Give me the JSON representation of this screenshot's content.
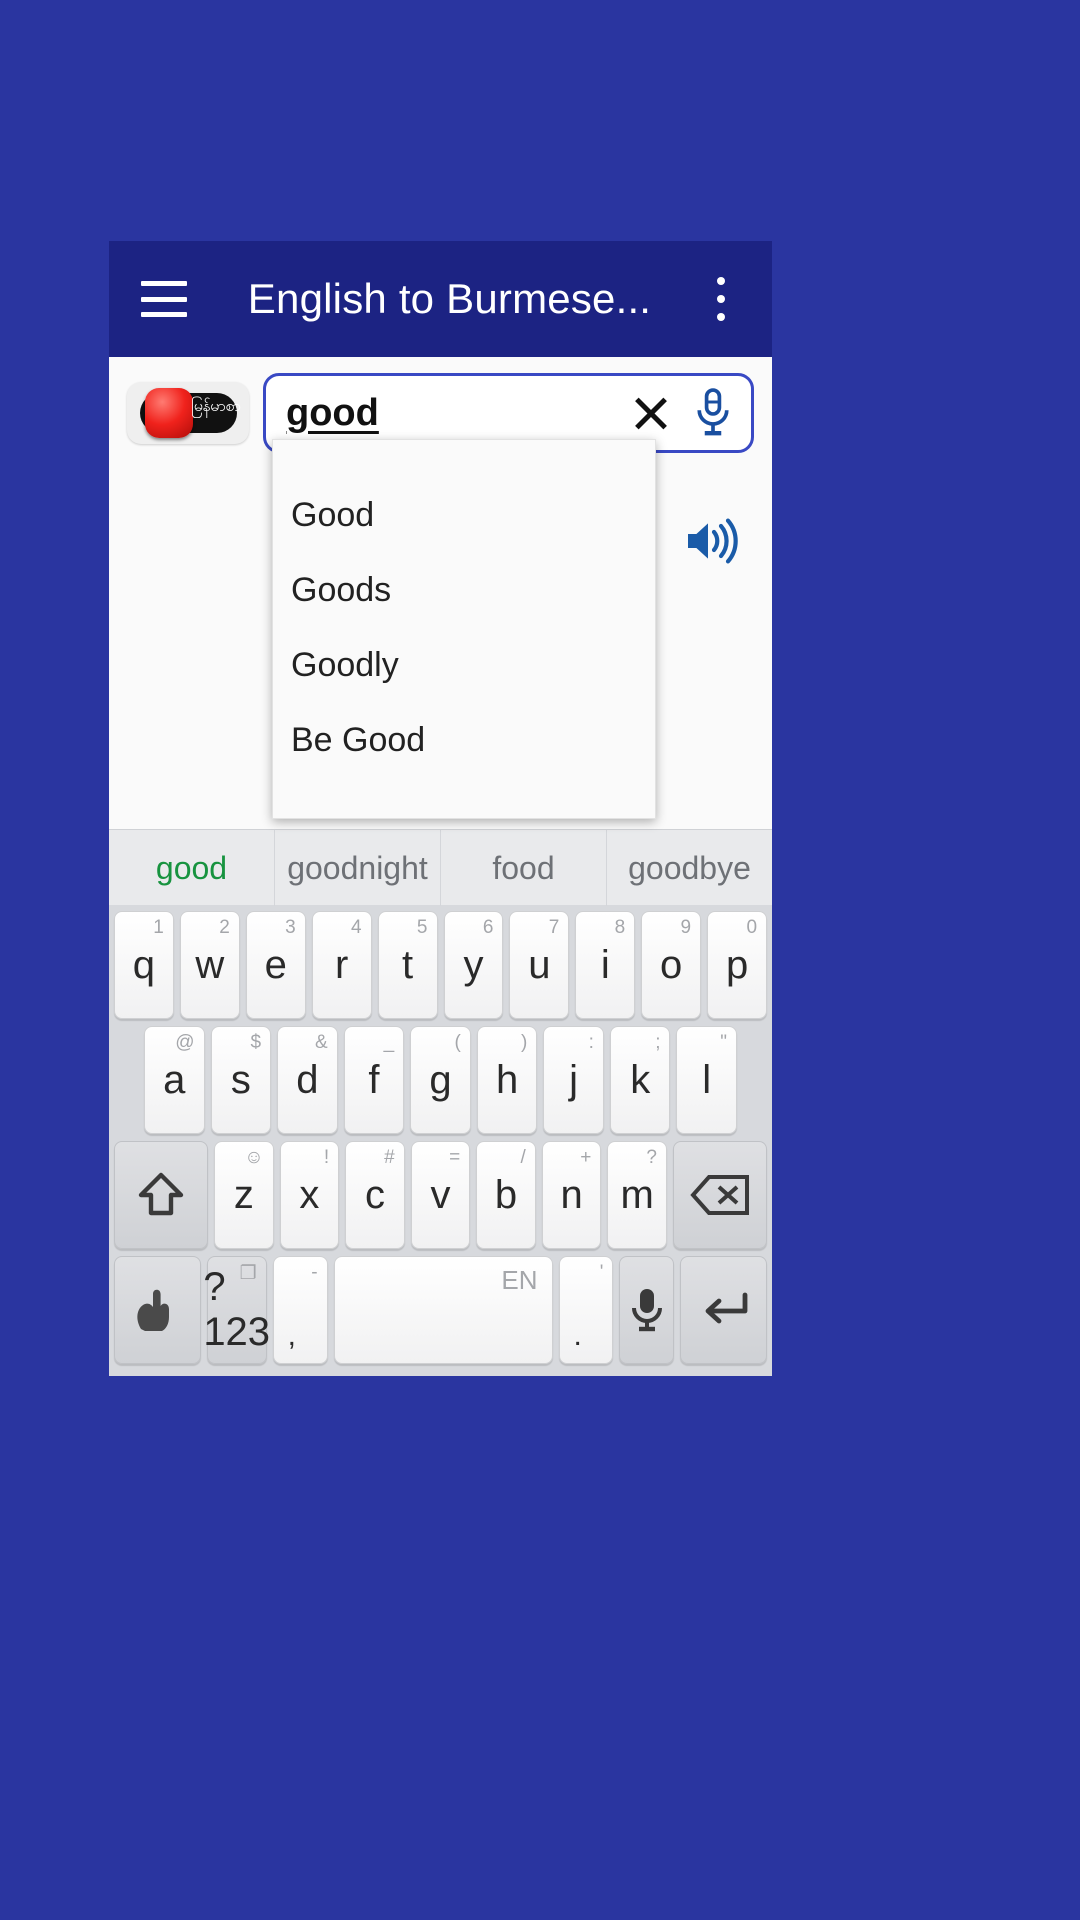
{
  "page": {
    "background_color": "#2A35A0"
  },
  "appbar": {
    "title": "English to Burmese...",
    "menu_icon": "hamburger-icon",
    "overflow_icon": "more-vertical-icon",
    "background_color": "#1C2383"
  },
  "search": {
    "app_logo_label": "မြန်မာစာ",
    "value": "good",
    "clear_icon": "close-icon",
    "mic_icon": "microphone-icon",
    "mic_color": "#1A4FA0"
  },
  "body": {
    "speaker_icon": "volume-up-icon",
    "speaker_color": "#1A5BA8"
  },
  "suggestions_dropdown": {
    "items": [
      {
        "label": "Good"
      },
      {
        "label": "Goods"
      },
      {
        "label": "Goodly"
      },
      {
        "label": "Be Good"
      }
    ]
  },
  "keyboard": {
    "suggestion_strip": [
      {
        "word": "good",
        "active": true
      },
      {
        "word": "goodnight",
        "active": false
      },
      {
        "word": "food",
        "active": false
      },
      {
        "word": "goodbye",
        "active": false
      }
    ],
    "active_color": "#17933F",
    "row1": [
      {
        "key": "q",
        "hint": "1"
      },
      {
        "key": "w",
        "hint": "2"
      },
      {
        "key": "e",
        "hint": "3"
      },
      {
        "key": "r",
        "hint": "4"
      },
      {
        "key": "t",
        "hint": "5"
      },
      {
        "key": "y",
        "hint": "6"
      },
      {
        "key": "u",
        "hint": "7"
      },
      {
        "key": "i",
        "hint": "8"
      },
      {
        "key": "o",
        "hint": "9"
      },
      {
        "key": "p",
        "hint": "0"
      }
    ],
    "row2": [
      {
        "key": "a",
        "hint": "@"
      },
      {
        "key": "s",
        "hint": "$"
      },
      {
        "key": "d",
        "hint": "&"
      },
      {
        "key": "f",
        "hint": "_"
      },
      {
        "key": "g",
        "hint": "("
      },
      {
        "key": "h",
        "hint": ")"
      },
      {
        "key": "j",
        "hint": ":"
      },
      {
        "key": "k",
        "hint": ";"
      },
      {
        "key": "l",
        "hint": "\""
      }
    ],
    "row3": [
      {
        "key": "z",
        "hint": "☺"
      },
      {
        "key": "x",
        "hint": "!"
      },
      {
        "key": "c",
        "hint": "#"
      },
      {
        "key": "v",
        "hint": "="
      },
      {
        "key": "b",
        "hint": "/"
      },
      {
        "key": "n",
        "hint": "+"
      },
      {
        "key": "m",
        "hint": "?"
      }
    ],
    "shift_icon": "shift-up-icon",
    "backspace_icon": "backspace-icon",
    "emoji_icon": "hand-gesture-icon",
    "symbols_key": "?123",
    "symbols_hint_icon": "window-icon",
    "comma_key": ",",
    "comma_hint": "-",
    "space_label": "EN",
    "period_key": ".",
    "period_hint": "'",
    "mic_key_icon": "microphone-icon",
    "enter_icon": "enter-return-icon"
  }
}
